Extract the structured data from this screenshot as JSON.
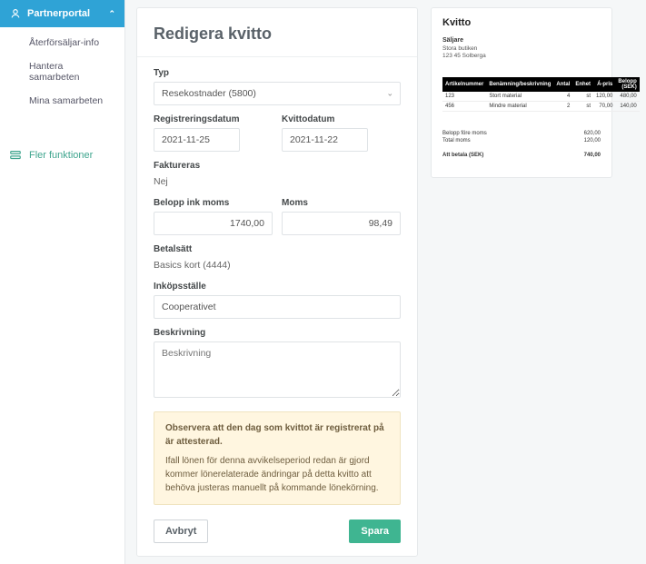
{
  "sidebar": {
    "header": "Partnerportal",
    "items": [
      {
        "label": "Återförsäljar-info"
      },
      {
        "label": "Hantera samarbeten"
      },
      {
        "label": "Mina samarbeten"
      }
    ],
    "more": "Fler funktioner"
  },
  "form": {
    "title": "Redigera kvitto",
    "type_label": "Typ",
    "type_value": "Resekostnader (5800)",
    "regdate_label": "Registreringsdatum",
    "regdate_value": "2021-11-25",
    "kvitto_label": "Kvittodatum",
    "kvitto_value": "2021-11-22",
    "invoiced_label": "Faktureras",
    "invoiced_value": "Nej",
    "amount_label": "Belopp ink moms",
    "amount_value": "1740,00",
    "vat_label": "Moms",
    "vat_value": "98,49",
    "payment_label": "Betalsätt",
    "payment_value": "Basics kort (4444)",
    "place_label": "Inköpsställe",
    "place_value": "Cooperativet",
    "desc_label": "Beskrivning",
    "desc_placeholder": "Beskrivning",
    "note_strong": "Observera att den dag som kvittot är registrerat på är attesterad.",
    "note_body": "Ifall lönen för denna avvikelseperiod redan är gjord kommer lönerelaterade ändringar på detta kvitto att behöva justeras manuellt på kommande lönekörning.",
    "cancel": "Avbryt",
    "save": "Spara"
  },
  "receipt": {
    "title": "Kvitto",
    "seller_heading": "Säljare",
    "seller_name": "Stora butiken",
    "seller_addr": "123 45 Solberga",
    "headers": {
      "artno": "Artikelnummer",
      "desc": "Benämning/beskrivning",
      "qty": "Antal",
      "unit": "Enhet",
      "aprice": "Á-pris",
      "sum": "Belopp (SEK)"
    },
    "rows": [
      {
        "artno": "123",
        "desc": "Stort material",
        "qty": "4",
        "unit": "st",
        "aprice": "120,00",
        "sum": "480,00"
      },
      {
        "artno": "456",
        "desc": "Mindre material",
        "qty": "2",
        "unit": "st",
        "aprice": "70,00",
        "sum": "140,00"
      }
    ],
    "totals": {
      "pre_vat_label": "Belopp före moms",
      "pre_vat": "620,00",
      "vat_label": "Total moms",
      "vat": "120,00",
      "pay_label": "Att betala (SEK)",
      "pay": "740,00"
    }
  }
}
